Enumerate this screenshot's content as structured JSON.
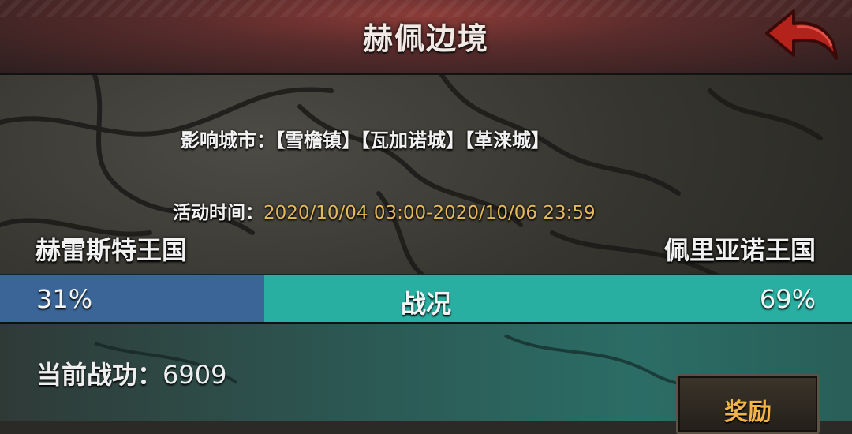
{
  "header": {
    "title": "赫佩边境",
    "back_icon": "back-arrow-icon",
    "accent_color": "#b3231c"
  },
  "event": {
    "cities_label": "影响城市：【雪檐镇】【瓦加诺城】【革涞城】",
    "time_label": "活动时间：",
    "time_value": "2020/10/04 03:00-2020/10/06 23:59"
  },
  "war": {
    "left_kingdom": "赫雷斯特王国",
    "right_kingdom": "佩里亚诺王国",
    "left_percent": "31%",
    "right_percent": "69%",
    "left_share": 0.31,
    "title": "战况",
    "left_color": "#3a6596",
    "right_color": "#28afa2"
  },
  "player": {
    "merit_label": "当前战功：",
    "merit_value": "6909"
  },
  "reward": {
    "label": "奖励"
  }
}
